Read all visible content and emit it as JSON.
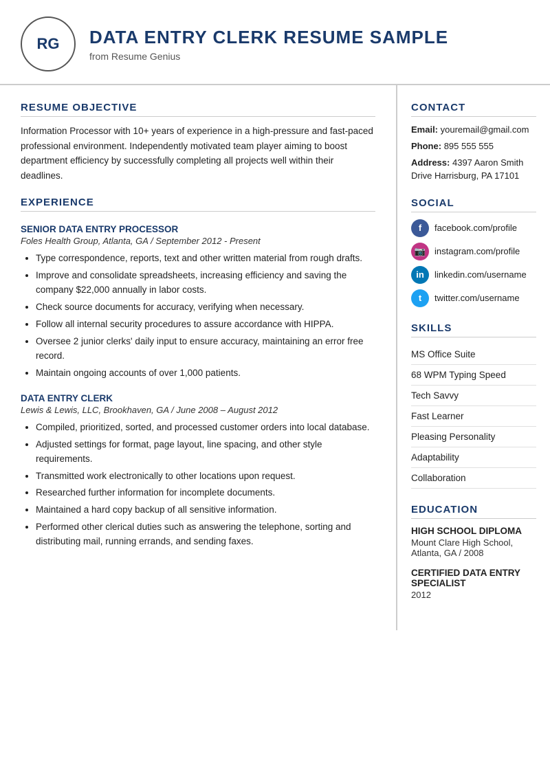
{
  "header": {
    "initials": "RG",
    "title": "DATA ENTRY CLERK RESUME SAMPLE",
    "subtitle": "from Resume Genius"
  },
  "left": {
    "objective_title": "RESUME OBJECTIVE",
    "objective_text": "Information Processor with 10+ years of experience in a high-pressure and fast-paced professional environment. Independently motivated team player aiming to boost department efficiency by successfully completing all projects well within their deadlines.",
    "experience_title": "EXPERIENCE",
    "jobs": [
      {
        "title": "SENIOR DATA ENTRY PROCESSOR",
        "company": "Foles Health Group, Atlanta, GA  /  September 2012 - Present",
        "bullets": [
          "Type correspondence, reports, text and other written material from rough drafts.",
          "Improve and consolidate spreadsheets, increasing efficiency and saving the company $22,000 annually in labor costs.",
          "Check source documents for accuracy, verifying when necessary.",
          "Follow all internal security procedures to assure accordance with HIPPA.",
          "Oversee 2 junior clerks' daily input to ensure accuracy, maintaining an error free record.",
          "Maintain ongoing accounts of over 1,000 patients."
        ]
      },
      {
        "title": "DATA ENTRY CLERK",
        "company": "Lewis & Lewis, LLC, Brookhaven, GA  /  June 2008 – August 2012",
        "bullets": [
          "Compiled, prioritized, sorted, and processed customer orders into local database.",
          "Adjusted settings for format, page layout, line spacing, and other style requirements.",
          "Transmitted work electronically to other locations upon request.",
          "Researched further information for incomplete documents.",
          "Maintained a hard copy backup of all sensitive information.",
          "Performed other clerical duties such as answering the telephone, sorting and distributing mail, running errands, and sending faxes."
        ]
      }
    ]
  },
  "right": {
    "contact_title": "CONTACT",
    "email_label": "Email:",
    "email_value": "youremail@gmail.com",
    "phone_label": "Phone:",
    "phone_value": "895 555 555",
    "address_label": "Address:",
    "address_value": "4397 Aaron Smith Drive Harrisburg, PA 17101",
    "social_title": "SOCIAL",
    "socials": [
      {
        "network": "facebook",
        "url": "facebook.com/profile"
      },
      {
        "network": "instagram",
        "url": "instagram.com/profile"
      },
      {
        "network": "linkedin",
        "url": "linkedin.com/username"
      },
      {
        "network": "twitter",
        "url": "twitter.com/username"
      }
    ],
    "skills_title": "SKILLS",
    "skills": [
      "MS Office Suite",
      "68 WPM Typing Speed",
      "Tech Savvy",
      "Fast Learner",
      "Pleasing Personality",
      "Adaptability",
      "Collaboration"
    ],
    "education_title": "EDUCATION",
    "education": [
      {
        "degree": "HIGH SCHOOL DIPLOMA",
        "school": "Mount Clare High School, Atlanta, GA / 2008"
      },
      {
        "degree": "CERTIFIED DATA ENTRY SPECIALIST",
        "school": "2012"
      }
    ]
  }
}
